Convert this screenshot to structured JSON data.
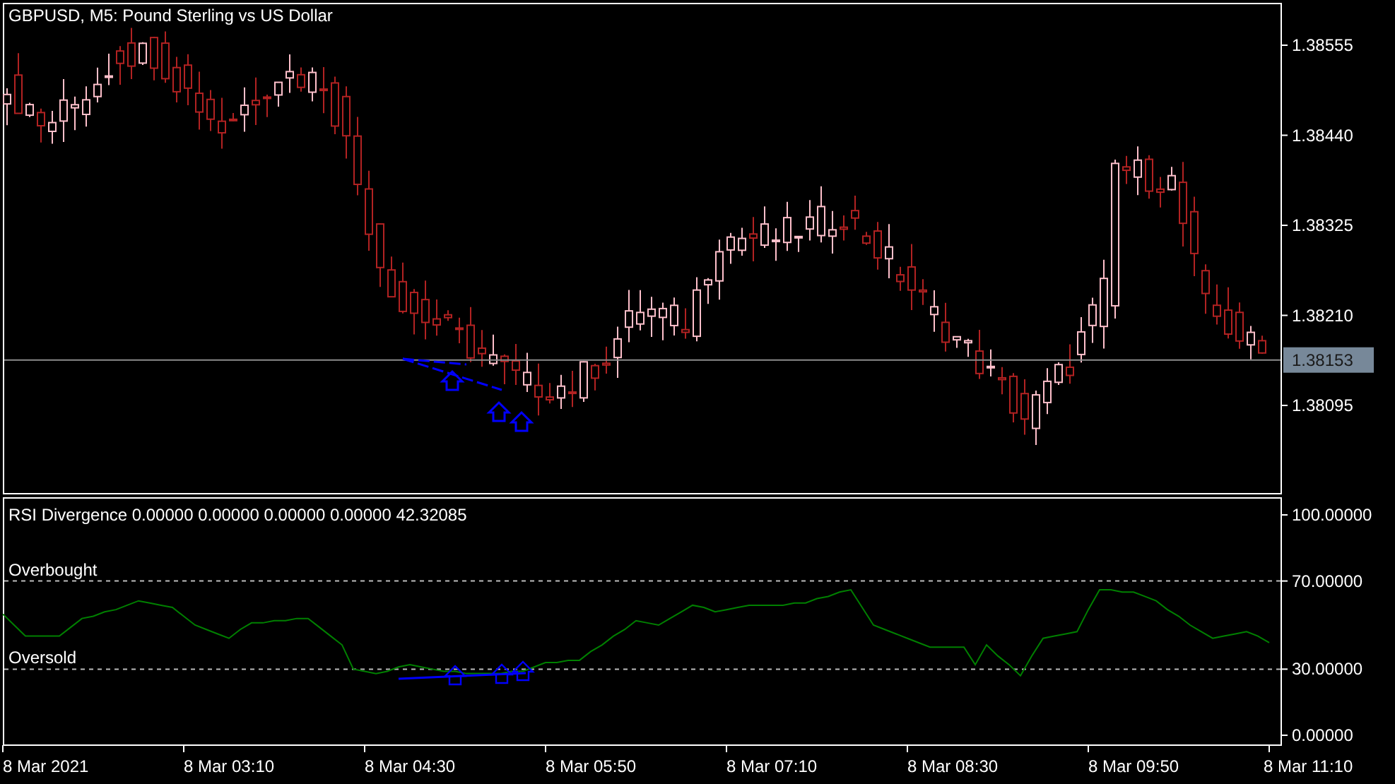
{
  "main_chart": {
    "title": "GBPUSD, M5:  Pound Sterling vs US Dollar",
    "price_labels": [
      "1.38555",
      "1.38440",
      "1.38325",
      "1.38210",
      "1.38095"
    ],
    "current_price": "1.38153"
  },
  "rsi_panel": {
    "title": "RSI Divergence 0.00000 0.00000 0.00000 0.00000 42.32085",
    "chart_data": {
      "type": "line",
      "series": [
        {
          "color": "#008000",
          "values": [
            55,
            50,
            45,
            45,
            45,
            45,
            49,
            53,
            54,
            56,
            57,
            59,
            61,
            60,
            59,
            58,
            54,
            50,
            48,
            46,
            44,
            48,
            51,
            51,
            52,
            52,
            53,
            53,
            49,
            45,
            41,
            30,
            29,
            28,
            29,
            31,
            32,
            31,
            30,
            29,
            29,
            28,
            28,
            28,
            28,
            29,
            29,
            31,
            33,
            33,
            34,
            34,
            38,
            41,
            45,
            48,
            52,
            51,
            50,
            53,
            56,
            59,
            58,
            56,
            57,
            58,
            59,
            59,
            59,
            59,
            60,
            60,
            62,
            63,
            65,
            66,
            58,
            50,
            48,
            46,
            44,
            42,
            40,
            40,
            40,
            40,
            32,
            41,
            36,
            32,
            27,
            36,
            44,
            45,
            46,
            47,
            57,
            66,
            66,
            65,
            65,
            63,
            61,
            57,
            54,
            50,
            47,
            44,
            45,
            46,
            47,
            45,
            42
          ]
        }
      ],
      "ylim": [
        -4.5,
        107.7
      ],
      "yticks": [
        {
          "value": 100,
          "label": "100.00000"
        },
        {
          "value": 70,
          "label": "70.00000"
        },
        {
          "value": 30,
          "label": "30.00000"
        },
        {
          "value": 0,
          "label": "0.00000"
        }
      ]
    },
    "level_labels": [
      "Overbought",
      "Oversold"
    ],
    "time_labels": [
      "8 Mar 2021",
      "8 Mar 03:10",
      "8 Mar 04:30",
      "8 Mar 05:50",
      "8 Mar 07:10",
      "8 Mar 08:30",
      "8 Mar 09:50",
      "8 Mar 11:10"
    ]
  }
}
